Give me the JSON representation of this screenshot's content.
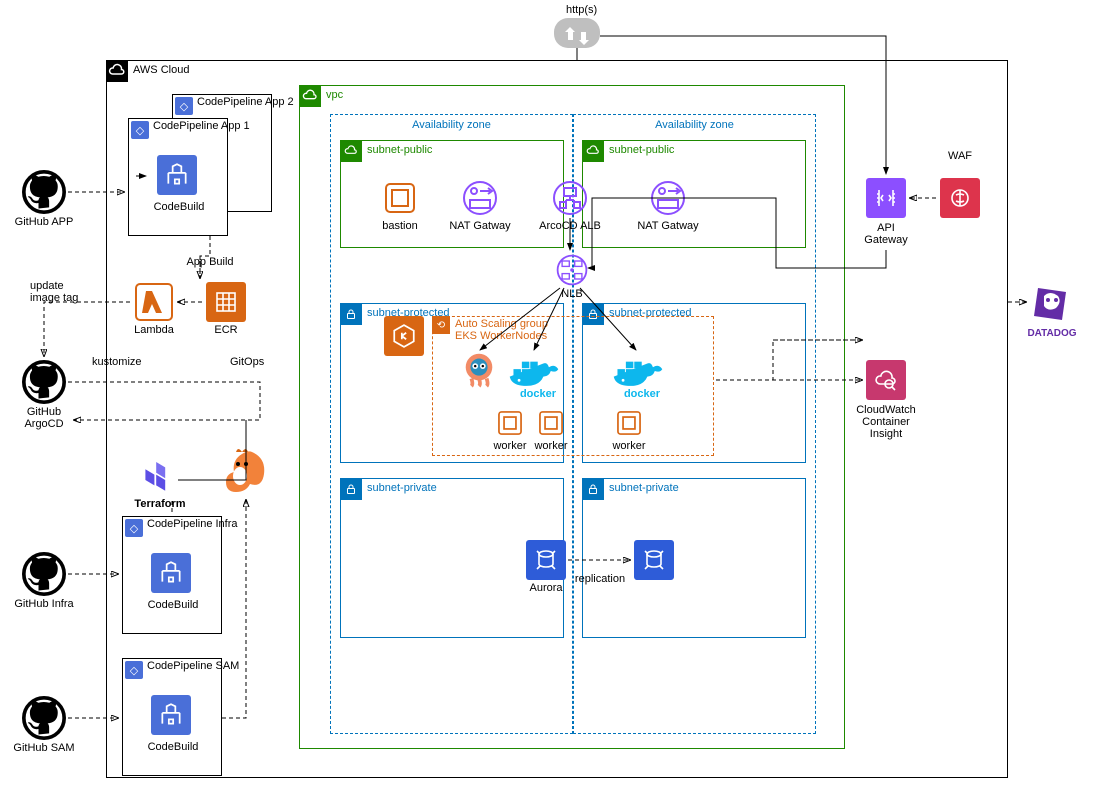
{
  "title_http": "http(s)",
  "aws_cloud": "AWS Cloud",
  "vpc": "vpc",
  "az": "Availability zone",
  "subnet_public": "subnet-public",
  "subnet_protected": "subnet-protected",
  "subnet_private": "subnet-private",
  "github_app": "GitHub APP",
  "github_argocd_1": "GitHub",
  "github_argocd_2": "ArgoCD",
  "github_infra": "GitHub Infra",
  "github_sam": "GitHub SAM",
  "cp_app2": "CodePipeline App 2",
  "cp_app1": "CodePipeline App 1",
  "cp_infra": "CodePipeline Infra",
  "cp_sam": "CodePipeline SAM",
  "codebuild": "CodeBuild",
  "app_build": "App Build",
  "lambda": "Lambda",
  "ecr": "ECR",
  "update_image_tag_1": "update",
  "update_image_tag_2": "image tag",
  "kustomize": "kustomize",
  "gitops": "GitOps",
  "terraform": "Terraform",
  "bastion": "bastion",
  "nat": "NAT Gatway",
  "argocd_alb": "ArcoCD ALB",
  "nlb": "NLB",
  "asg_1": "Auto Scaling group",
  "asg_2": "EKS WorkerNodes",
  "docker": "docker",
  "worker": "worker",
  "aurora": "Aurora",
  "replication": "replication",
  "api_gw_1": "API",
  "api_gw_2": "Gateway",
  "waf": "WAF",
  "cw_1": "CloudWatch",
  "cw_2": "Container",
  "cw_3": "Insight",
  "datadog": "DATADOG",
  "colors": {
    "aws_border": "#000000",
    "vpc_border": "#1e8900",
    "az_border": "#0073bb",
    "subnet_green": "#1e8900",
    "subnet_blue": "#0073bb",
    "lambda_border": "#d86613",
    "asg_border": "#d86613",
    "eks_bg": "#d86613",
    "pipeline_bg": "#4a6fd8",
    "waf_bg": "#dd344c",
    "apigw_bg": "#8c4fff",
    "cloudwatch_bg": "#c7386e",
    "rds_bg": "#2e5cd8",
    "alb_stroke": "#8c4fff",
    "nat_stroke": "#8c4fff",
    "bastion_stroke": "#d86613",
    "docker_blue": "#0db7ed"
  }
}
